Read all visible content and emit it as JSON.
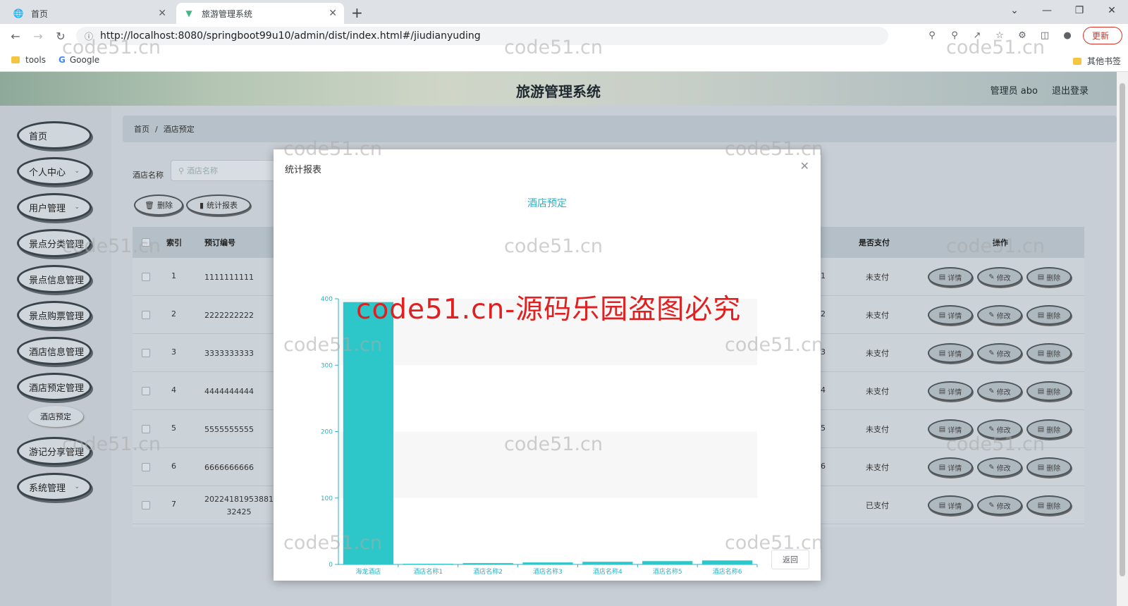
{
  "browser": {
    "tabs": [
      {
        "title": "首页",
        "icon": "globe-icon"
      },
      {
        "title": "旅游管理系统",
        "icon": "vue-icon"
      }
    ],
    "url": "http://localhost:8080/springboot99u10/admin/dist/index.html#/jiudianyuding",
    "update_label": "更新",
    "bookmarks": [
      {
        "label": "tools",
        "icon": "folder-icon"
      },
      {
        "label": "Google",
        "icon": "google-icon"
      }
    ],
    "other_bookmarks": "其他书签"
  },
  "app": {
    "title": "旅游管理系统",
    "user": "管理员 abo",
    "logout": "退出登录"
  },
  "sidebar": {
    "items": [
      {
        "label": "首页",
        "caret": false
      },
      {
        "label": "个人中心",
        "caret": true
      },
      {
        "label": "用户管理",
        "caret": true
      },
      {
        "label": "景点分类管理",
        "caret": false
      },
      {
        "label": "景点信息管理",
        "caret": false
      },
      {
        "label": "景点购票管理",
        "caret": false
      },
      {
        "label": "酒店信息管理",
        "caret": false
      },
      {
        "label": "酒店预定管理",
        "caret": false
      },
      {
        "label": "游记分享管理",
        "caret": false
      },
      {
        "label": "系统管理",
        "caret": true
      }
    ],
    "sub_item": "酒店预定"
  },
  "breadcrumb": [
    "首页",
    "/",
    "酒店预定"
  ],
  "search": {
    "label": "酒店名称",
    "placeholder": "酒店名称"
  },
  "actions": {
    "delete": "删除",
    "stats": "统计报表"
  },
  "table": {
    "headers": [
      "索引",
      "预订编号",
      "是否支付",
      "操作"
    ],
    "rows": [
      {
        "index": "1",
        "order_no": "1111111111",
        "partial": "1",
        "paid": "未支付"
      },
      {
        "index": "2",
        "order_no": "2222222222",
        "partial": "2",
        "paid": "未支付"
      },
      {
        "index": "3",
        "order_no": "3333333333",
        "partial": "3",
        "paid": "未支付"
      },
      {
        "index": "4",
        "order_no": "4444444444",
        "partial": "4",
        "paid": "未支付"
      },
      {
        "index": "5",
        "order_no": "5555555555",
        "partial": "5",
        "paid": "未支付"
      },
      {
        "index": "6",
        "order_no": "6666666666",
        "partial": "6",
        "paid": "未支付"
      },
      {
        "index": "7",
        "order_no": "20224181953881\n32425",
        "partial": "",
        "paid": "已支付"
      }
    ],
    "op_labels": {
      "detail": "详情",
      "edit": "修改",
      "delete": "删除"
    }
  },
  "dialog": {
    "title": "统计报表",
    "back": "返回"
  },
  "chart_data": {
    "type": "bar",
    "title": "酒店预定",
    "categories": [
      "海龙酒店",
      "酒店名称1",
      "酒店名称2",
      "酒店名称3",
      "酒店名称4",
      "酒店名称5",
      "酒店名称6"
    ],
    "values": [
      395,
      1,
      2,
      3,
      4,
      5,
      6
    ],
    "ylim": [
      0,
      400
    ],
    "yticks": [
      0,
      100,
      200,
      300,
      400
    ],
    "color": "#2ec7c9",
    "grid": true
  },
  "watermark": {
    "text": "code51.cn",
    "big_text": "code51.cn-源码乐园盗图必究"
  }
}
